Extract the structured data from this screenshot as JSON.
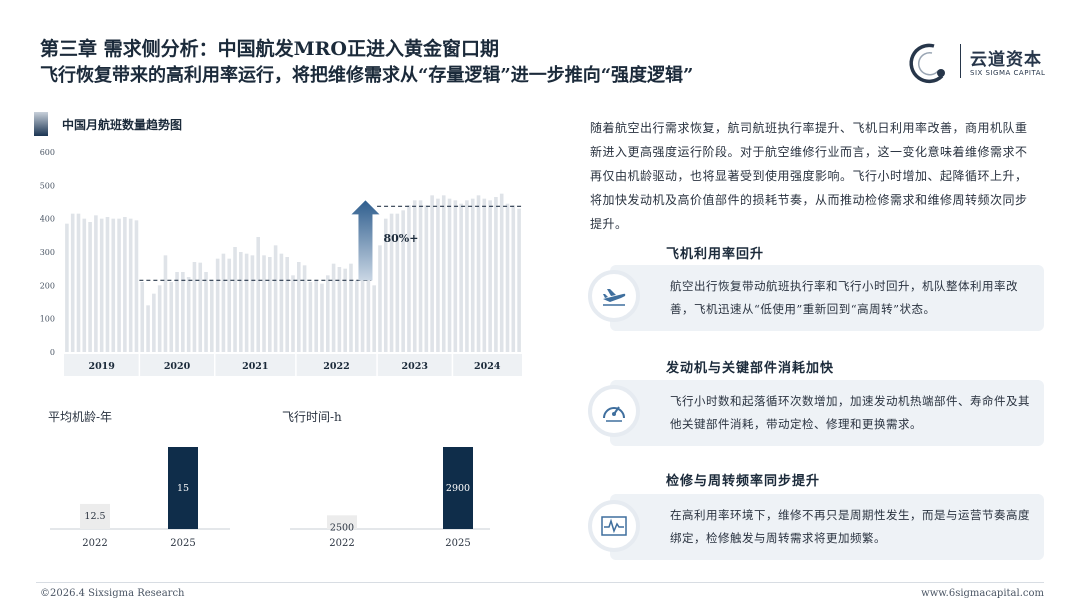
{
  "header": {
    "title_line1": "第三章 需求侧分析：中国航发MRO正进入黄金窗口期",
    "title_line2": "飞行恢复带来的高利用率运行，将把维修需求从“存量逻辑”进一步推向“强度逻辑”"
  },
  "logo": {
    "text": "云道资本",
    "sub": "SIX SIGMA CAPITAL"
  },
  "main_chart": {
    "title": "中国月航班数量趋势图",
    "annotation": "80%+",
    "chart_data": {
      "type": "bar",
      "ylim": [
        0,
        600
      ],
      "yticks": [
        "0",
        "100",
        "200",
        "300",
        "400",
        "500",
        "600"
      ],
      "year_labels": [
        "2019",
        "2020",
        "2021",
        "2022",
        "2023",
        "2024"
      ],
      "values": [
        385,
        415,
        415,
        400,
        390,
        410,
        400,
        405,
        400,
        400,
        405,
        400,
        395,
        210,
        140,
        175,
        200,
        290,
        210,
        240,
        240,
        225,
        270,
        268,
        240,
        215,
        280,
        295,
        280,
        315,
        300,
        295,
        290,
        345,
        290,
        285,
        320,
        295,
        285,
        230,
        270,
        260,
        210,
        215,
        205,
        230,
        265,
        255,
        250,
        265,
        215,
        240,
        220,
        200,
        320,
        400,
        415,
        415,
        425,
        440,
        455,
        455,
        440,
        470,
        460,
        470,
        460,
        455,
        445,
        455,
        460,
        470,
        460,
        455,
        465,
        475,
        445,
        440,
        430
      ],
      "ref_lines": [
        {
          "value": 215,
          "label": "low-avg"
        },
        {
          "value": 437,
          "label": "recent-avg"
        }
      ]
    }
  },
  "mini_left": {
    "label": "平均机龄-年",
    "chart_data": {
      "type": "bar",
      "categories": [
        "2022",
        "2025"
      ],
      "values": [
        12.5,
        15
      ],
      "value_labels": [
        "12.5",
        "15"
      ]
    }
  },
  "mini_right": {
    "label": "飞行时间-h",
    "chart_data": {
      "type": "bar",
      "categories": [
        "2022",
        "2025"
      ],
      "values": [
        2500,
        2900
      ],
      "value_labels": [
        "2500",
        "2900"
      ]
    }
  },
  "intro_text": "随着航空出行需求恢复，航司航班执行率提升、飞机日利用率改善，商用机队重新进入更高强度运行阶段。对于航空维修行业而言，这一变化意味着维修需求不再仅由机龄驱动，也将显著受到使用强度影响。飞行小时增加、起降循环上升，将加快发动机及高价值部件的损耗节奏，从而推动检修需求和维修周转频次同步提升。",
  "sections": [
    {
      "title": "飞机利用率回升",
      "text": "航空出行恢复带动航班执行率和飞行小时回升，机队整体利用率改善，飞机迅速从“低使用”重新回到“高周转”状态。",
      "icon": "airplane-icon"
    },
    {
      "title": "发动机与关键部件消耗加快",
      "text": "飞行小时数和起落循环次数增加，加速发动机热端部件、寿命件及其他关键部件消耗，带动定检、修理和更换需求。",
      "icon": "gauge-icon"
    },
    {
      "title": "检修与周转频率同步提升",
      "text": "在高利用率环境下，维修不再只是周期性发生，而是与运营节奏高度绑定，检修触发与周转需求将更加频繁。",
      "icon": "pulse-icon"
    }
  ],
  "footer": {
    "left": "©2026.4 Sixsigma Research",
    "right": "www.6sigmacapital.com"
  },
  "colors": {
    "navy": "#0f2d4a",
    "bar": "#dfe3e8",
    "accent": "#3f6f9e"
  }
}
